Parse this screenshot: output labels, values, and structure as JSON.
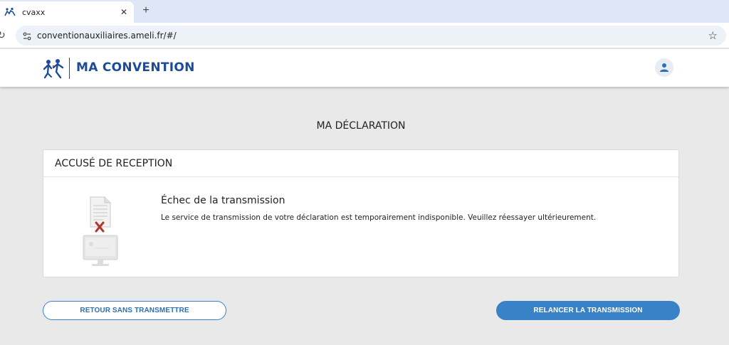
{
  "browser": {
    "tab_title": "cvaxx",
    "tab_close": "✕",
    "new_tab": "+",
    "url": "conventionauxiliaires.ameli.fr/#/",
    "star": "☆",
    "reload": "↻"
  },
  "header": {
    "brand": "MA CONVENTION",
    "brand_color": "#1b4b9a",
    "logo_icon": "ameli-logo-icon",
    "user_icon": "user-icon"
  },
  "page": {
    "title": "MA DÉCLARATION"
  },
  "card": {
    "title": "ACCUSÉ DE RECEPTION",
    "message_title": "Échec de la transmission",
    "message_text": "Le service de transmission de votre déclaration est temporairement indisponible. Veuillez réessayer ultérieurement.",
    "illustration_icon": "failed-transmission-icon"
  },
  "actions": {
    "back_label": "RETOUR SANS TRANSMETTRE",
    "retry_label": "RELANCER LA TRANSMISSION",
    "accent_color": "#3a82c7"
  }
}
